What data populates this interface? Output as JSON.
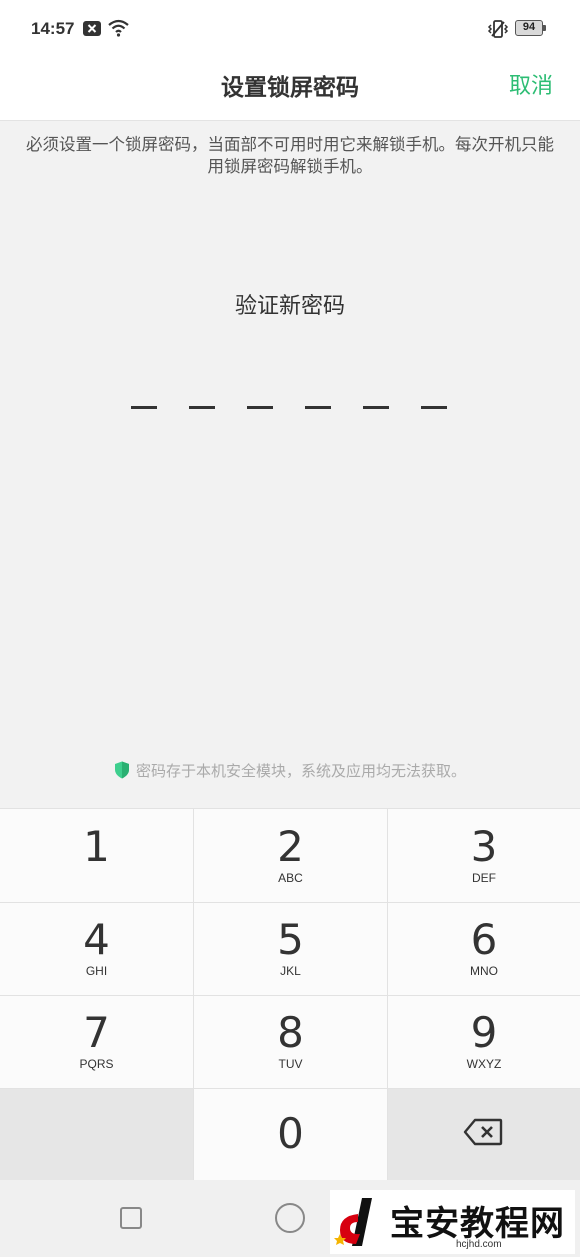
{
  "status_bar": {
    "time": "14:57",
    "battery": "94",
    "icons": [
      "notification-x-icon",
      "wifi-icon",
      "vibrate-icon",
      "battery-icon"
    ]
  },
  "header": {
    "title": "设置锁屏密码",
    "cancel_label": "取消"
  },
  "description": "必须设置一个锁屏密码，当面部不可用时用它来解锁手机。每次开机只能用锁屏密码解锁手机。",
  "prompt": "验证新密码",
  "pin_length": 6,
  "secure_note": "密码存于本机安全模块，系统及应用均无法获取。",
  "keypad": {
    "keys": [
      {
        "digit": "1",
        "letters": ""
      },
      {
        "digit": "2",
        "letters": "ABC"
      },
      {
        "digit": "3",
        "letters": "DEF"
      },
      {
        "digit": "4",
        "letters": "GHI"
      },
      {
        "digit": "5",
        "letters": "JKL"
      },
      {
        "digit": "6",
        "letters": "MNO"
      },
      {
        "digit": "7",
        "letters": "PQRS"
      },
      {
        "digit": "8",
        "letters": "TUV"
      },
      {
        "digit": "9",
        "letters": "WXYZ"
      },
      {
        "digit": "0",
        "letters": ""
      }
    ]
  },
  "watermark": {
    "text": "宝安教程网",
    "url": "hcjhd.com"
  },
  "colors": {
    "accent": "#2dbd74",
    "background": "#f2f2f2",
    "shield": "#3ecf8e"
  }
}
